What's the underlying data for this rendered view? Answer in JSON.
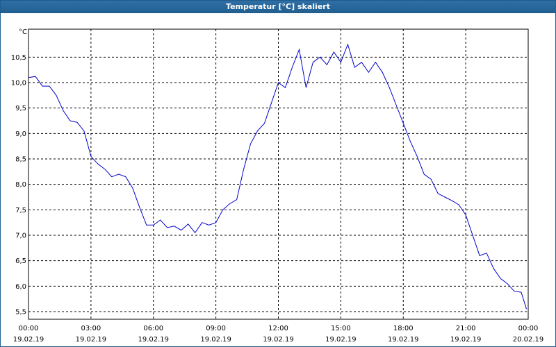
{
  "window": {
    "title": "Temperatur [°C] skaliert"
  },
  "chart_data": {
    "type": "line",
    "title": "Temperatur [°C] skaliert",
    "ylabel": "°C",
    "xlabel": "",
    "ylim": [
      5.35,
      11.05
    ],
    "xlim": [
      "19.02.19 00:00",
      "20.02.19 00:00"
    ],
    "grid": true,
    "y_ticks": [
      "5,5",
      "6,0",
      "6,5",
      "7,0",
      "7,5",
      "8,0",
      "8,5",
      "9,0",
      "9,5",
      "10,0",
      "10,5"
    ],
    "x_ticks": [
      {
        "time": "00:00",
        "date": "19.02.19"
      },
      {
        "time": "03:00",
        "date": "19.02.19"
      },
      {
        "time": "06:00",
        "date": "19.02.19"
      },
      {
        "time": "09:00",
        "date": "19.02.19"
      },
      {
        "time": "12:00",
        "date": "19.02.19"
      },
      {
        "time": "15:00",
        "date": "19.02.19"
      },
      {
        "time": "18:00",
        "date": "19.02.19"
      },
      {
        "time": "21:00",
        "date": "19.02.19"
      },
      {
        "time": "00:00",
        "date": "20.02.19"
      }
    ],
    "line_color": "#0000cc",
    "series": [
      {
        "x": [
          "00:00",
          "00:20",
          "00:40",
          "01:00",
          "01:20",
          "01:40",
          "02:00",
          "02:20",
          "02:40",
          "03:00",
          "03:20",
          "03:40",
          "04:00",
          "04:20",
          "04:40",
          "05:00",
          "05:20",
          "05:40",
          "06:00",
          "06:20",
          "06:40",
          "07:00",
          "07:20",
          "07:40",
          "08:00",
          "08:20",
          "08:40",
          "09:00",
          "09:20",
          "09:40",
          "10:00",
          "10:20",
          "10:40",
          "11:00",
          "11:20",
          "11:40",
          "12:00",
          "12:20",
          "12:40",
          "13:00",
          "13:20",
          "13:40",
          "14:00",
          "14:20",
          "14:40",
          "15:00",
          "15:20",
          "15:40",
          "16:00",
          "16:20",
          "16:40",
          "17:00",
          "17:20",
          "17:40",
          "18:00",
          "18:20",
          "18:40",
          "19:00",
          "19:20",
          "19:40",
          "20:00",
          "20:20",
          "20:40",
          "21:00",
          "21:20",
          "21:40",
          "22:00",
          "22:20",
          "22:40",
          "23:00",
          "23:20",
          "23:40",
          "23:55"
        ],
        "values": [
          10.1,
          10.12,
          9.93,
          9.93,
          9.75,
          9.45,
          9.25,
          9.22,
          9.05,
          8.55,
          8.4,
          8.3,
          8.15,
          8.2,
          8.15,
          7.93,
          7.55,
          7.2,
          7.2,
          7.3,
          7.15,
          7.18,
          7.1,
          7.22,
          7.05,
          7.25,
          7.2,
          7.25,
          7.5,
          7.62,
          7.7,
          8.3,
          8.8,
          9.05,
          9.2,
          9.6,
          10.0,
          9.9,
          10.3,
          10.65,
          9.9,
          10.4,
          10.5,
          10.35,
          10.6,
          10.4,
          10.75,
          10.3,
          10.4,
          10.2,
          10.4,
          10.2,
          9.9,
          9.55,
          9.2,
          8.85,
          8.55,
          8.2,
          8.1,
          7.82,
          7.75,
          7.68,
          7.6,
          7.4,
          7.0,
          6.6,
          6.65,
          6.35,
          6.15,
          6.05,
          5.9,
          5.88,
          5.55
        ]
      }
    ]
  }
}
